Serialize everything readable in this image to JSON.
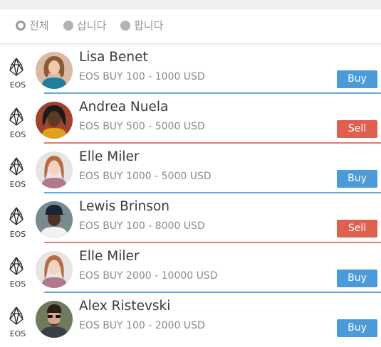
{
  "filters": [
    {
      "label": "전체",
      "selected": true
    },
    {
      "label": "삽니다",
      "selected": false
    },
    {
      "label": "팝니다",
      "selected": false
    }
  ],
  "colors": {
    "buy": "#4b9ad9",
    "sell": "#e0604f",
    "buy_line": "#6aa7dc",
    "sell_line": "#e27d70"
  },
  "offers": [
    {
      "coin_icon": "eos-icon",
      "coin_label": "EOS",
      "name": "Lisa Benet",
      "offer": "EOS BUY 100 - 1000 USD",
      "action": "Buy",
      "type": "buy"
    },
    {
      "coin_icon": "eos-icon",
      "coin_label": "EOS",
      "name": "Andrea Nuela",
      "offer": "EOS BUY 500 - 5000 USD",
      "action": "Sell",
      "type": "sell"
    },
    {
      "coin_icon": "eos-icon",
      "coin_label": "EOS",
      "name": "Elle Miler",
      "offer": "EOS BUY 1000 - 5000 USD",
      "action": "Buy",
      "type": "buy"
    },
    {
      "coin_icon": "eos-icon",
      "coin_label": "EOS",
      "name": "Lewis Brinson",
      "offer": "EOS BUY 100 - 8000 USD",
      "action": "Sell",
      "type": "sell"
    },
    {
      "coin_icon": "eos-icon",
      "coin_label": "EOS",
      "name": "Elle Miler",
      "offer": "EOS BUY 2000 - 10000 USD",
      "action": "Buy",
      "type": "buy"
    },
    {
      "coin_icon": "eos-icon",
      "coin_label": "EOS",
      "name": "Alex Ristevski",
      "offer": "EOS BUY 100 - 2000 USD",
      "action": "Buy",
      "type": "buy"
    }
  ]
}
